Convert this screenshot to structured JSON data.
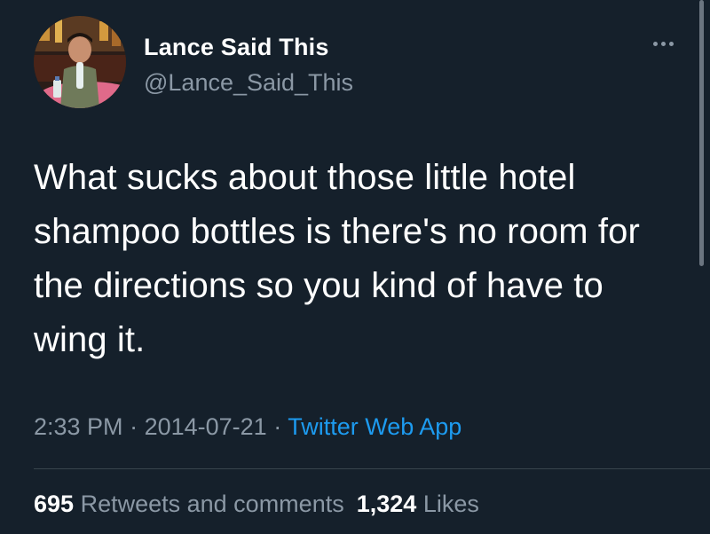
{
  "author": {
    "display_name": "Lance Said This",
    "handle": "@Lance_Said_This",
    "avatar_icon": "profile-photo"
  },
  "menu_icon": "more-options-icon",
  "tweet": {
    "text": "What sucks about those little hotel\nshampoo bottles is there's no room for\nthe directions so you kind of have to\nwing it."
  },
  "meta": {
    "time": "2:33 PM",
    "separator": " · ",
    "date": "2014-07-21",
    "source": "Twitter Web App"
  },
  "stats": {
    "retweets_count": "695",
    "retweets_label": "Retweets and comments",
    "likes_count": "1,324",
    "likes_label": "Likes"
  },
  "colors": {
    "background": "#15202b",
    "secondary_text": "#8b98a5",
    "link": "#1d9bf0",
    "divider": "#38444d"
  }
}
